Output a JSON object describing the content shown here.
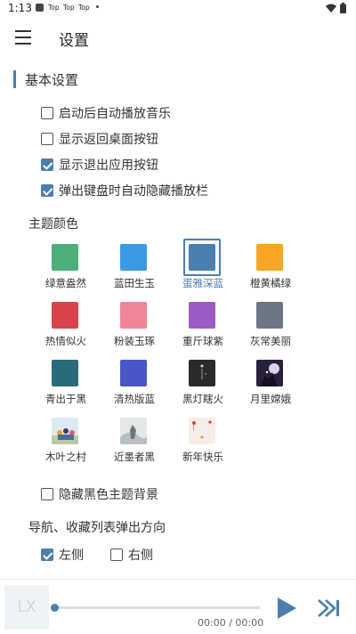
{
  "status_bar": {
    "time": "1:13",
    "notifications": [
      "Top",
      "Top",
      "Top"
    ]
  },
  "header": {
    "title": "设置",
    "menu_icon": "menu-icon"
  },
  "basic": {
    "title": "基本设置",
    "options": [
      {
        "label": "启动后自动播放音乐",
        "checked": false
      },
      {
        "label": "显示返回桌面按钮",
        "checked": false
      },
      {
        "label": "显示退出应用按钮",
        "checked": true
      },
      {
        "label": "弹出键盘时自动隐藏播放栏",
        "checked": true
      }
    ]
  },
  "theme": {
    "title": "主题颜色",
    "items": [
      {
        "name": "绿意盎然",
        "color": "#4caf7a",
        "selected": false
      },
      {
        "name": "蓝田生玉",
        "color": "#3a9ae3",
        "selected": false
      },
      {
        "name": "蛋雅深蓝",
        "color": "#4a7fb0",
        "selected": true
      },
      {
        "name": "橙黄橘绿",
        "color": "#f5a623",
        "selected": false
      },
      {
        "name": "热情似火",
        "color": "#d9434a",
        "selected": false
      },
      {
        "name": "粉装玉琢",
        "color": "#f08597",
        "selected": false
      },
      {
        "name": "重斤球紫",
        "color": "#9c5bc4",
        "selected": false
      },
      {
        "name": "灰常美丽",
        "color": "#6b7785",
        "selected": false
      },
      {
        "name": "青出于黑",
        "color": "#2b6a7a",
        "selected": false
      },
      {
        "name": "清热版蓝",
        "color": "#4a55c8",
        "selected": false
      },
      {
        "name": "黑灯瞎火",
        "color": "#2a2a2a",
        "selected": false
      },
      {
        "name": "月里嫦娥",
        "color": "#2a1f3d",
        "selected": false
      },
      {
        "name": "木叶之村",
        "color": "#d8e6f0",
        "selected": false
      },
      {
        "name": "近墨者黑",
        "color": "#cfd6d8",
        "selected": false
      },
      {
        "name": "新年快乐",
        "color": "#f4ece4",
        "selected": false
      }
    ],
    "hide_black_bg": {
      "label": "隐藏黑色主题背景",
      "checked": false
    }
  },
  "popup_direction": {
    "title": "导航、收藏列表弹出方向",
    "options": [
      {
        "label": "左侧",
        "checked": true
      },
      {
        "label": "右侧",
        "checked": false
      }
    ]
  },
  "player": {
    "cover_text": "LX",
    "time": "00:00 / 00:00",
    "progress": 0,
    "accent": "#4a7fb0"
  }
}
